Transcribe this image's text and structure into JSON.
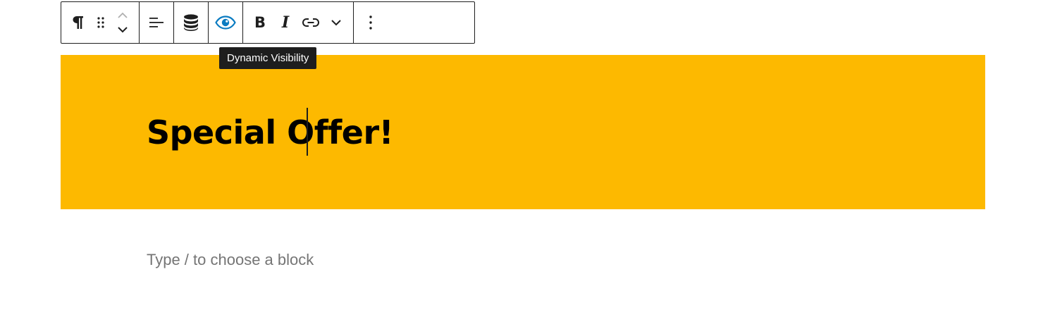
{
  "toolbar": {
    "groups": {
      "block": {
        "paragraph_icon": "pilcrow-icon",
        "drag_icon": "drag-handle-icon",
        "move_up_icon": "chevron-up-icon",
        "move_down_icon": "chevron-down-icon"
      },
      "align": {
        "icon": "align-left-icon"
      },
      "dynamic_data": {
        "icon": "database-icon"
      },
      "visibility": {
        "icon": "eye-icon",
        "accent_color": "#0a7bc1"
      },
      "format": {
        "bold_label": "B",
        "italic_label": "I",
        "link_icon": "link-icon",
        "more_icon": "chevron-down-icon"
      },
      "options": {
        "icon": "vertical-ellipsis-icon"
      }
    }
  },
  "tooltip": {
    "text": "Dynamic Visibility"
  },
  "banner": {
    "heading": "Special Offer!",
    "background_color": "#fdb900"
  },
  "editor": {
    "placeholder": "Type / to choose a block"
  }
}
